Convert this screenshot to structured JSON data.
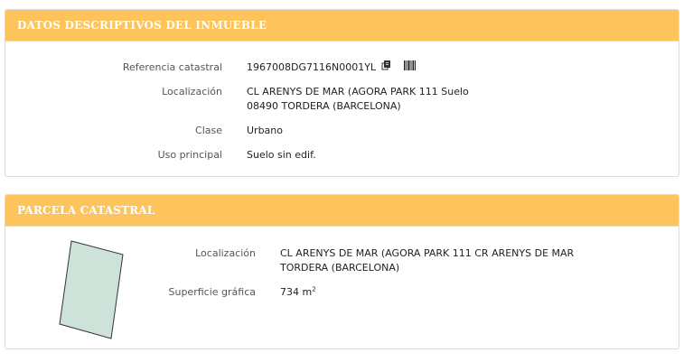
{
  "inmueble": {
    "title": "DATOS DESCRIPTIVOS DEL INMUEBLE",
    "referencia_label": "Referencia catastral",
    "referencia_value": "1967008DG7116N0001YL",
    "copy_icon": "copy-icon",
    "barcode_icon": "barcode-icon",
    "localizacion_label": "Localización",
    "localizacion_line1": "CL ARENYS DE MAR (AGORA PARK 111 Suelo",
    "localizacion_line2": "08490 TORDERA (BARCELONA)",
    "clase_label": "Clase",
    "clase_value": "Urbano",
    "uso_label": "Uso principal",
    "uso_value": "Suelo sin edif."
  },
  "parcela": {
    "title": "PARCELA CATASTRAL",
    "localizacion_label": "Localización",
    "localizacion_line1": "CL ARENYS DE MAR (AGORA PARK 111 CR ARENYS DE MAR",
    "localizacion_line2": "TORDERA (BARCELONA)",
    "superficie_label": "Superficie gráfica",
    "superficie_value": "734 m",
    "superficie_unit_sup": "2",
    "plot_fill": "#cde3d9",
    "plot_stroke": "#333333"
  },
  "colors": {
    "header_bg": "#fcc45a",
    "header_text": "#ffffff"
  }
}
